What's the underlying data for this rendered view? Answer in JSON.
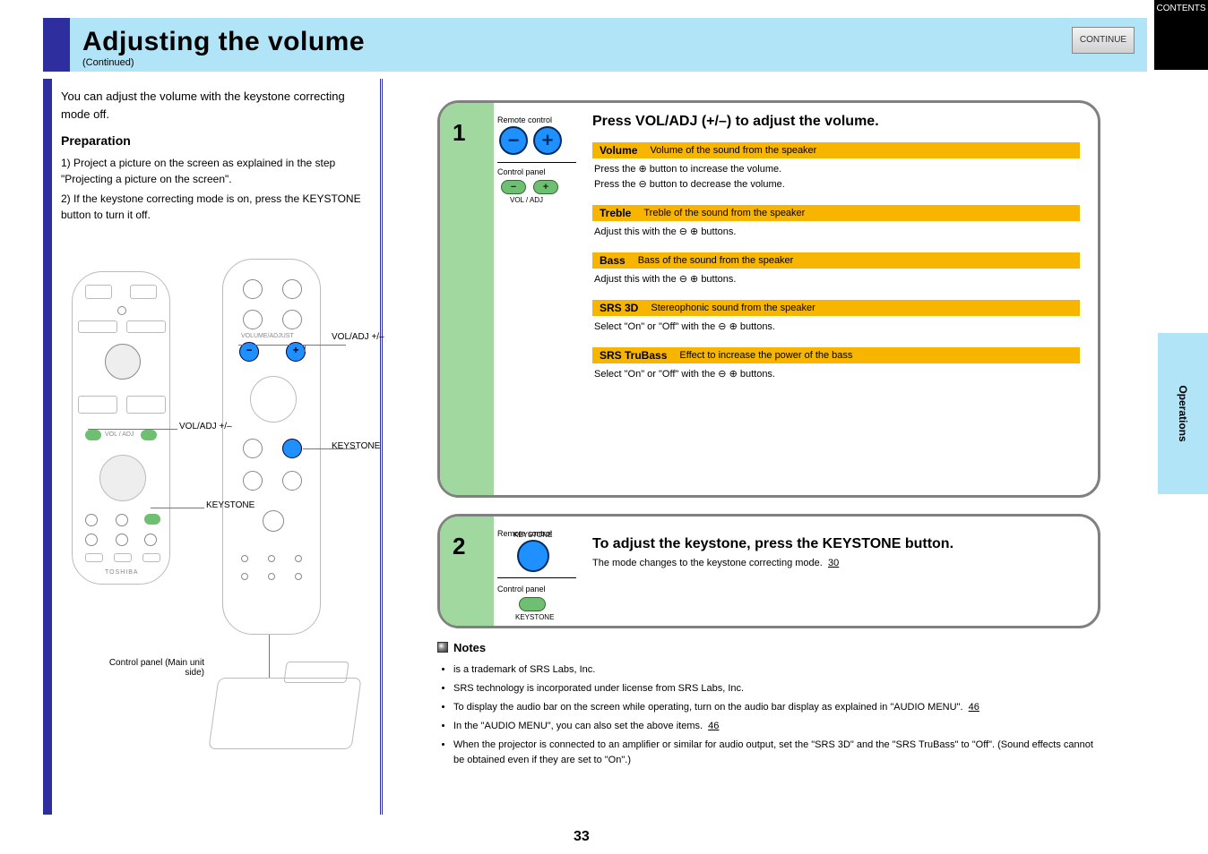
{
  "header": {
    "title": "Adjusting the volume",
    "subtitle": "(Continued)",
    "continue_btn": "CONTINUE",
    "contents_tab": "CONTENTS"
  },
  "side_tab": "Operations",
  "page_number": "33",
  "left": {
    "intro": "You can adjust the volume with the keystone correcting mode off.",
    "preparation_title": "Preparation",
    "preparation_items": [
      "1) Project a picture on the screen as explained in the step \"Projecting a picture on the screen\".",
      "2) If the keystone correcting mode is on, press the KEYSTONE button to turn it off."
    ],
    "callouts": {
      "vol_plus_minus_top": "VOL/ADJ +/–",
      "vol_plus_minus_left": "VOL/ADJ +/–",
      "keystone_right": "KEYSTONE",
      "keystone_left": "KEYSTONE",
      "control_panel": "Control panel (Main unit side)"
    },
    "remote_brand": "TOSHIBA",
    "volume_word_top": "VOLUME/ADJUST",
    "volume_word_bottom": "VOL / ADJ"
  },
  "right": {
    "step1": {
      "num": "1",
      "remote_label": "Remote control",
      "control_label": "Control panel",
      "title": "Press VOL/ADJ (+/–) to adjust the volume.",
      "bars": [
        {
          "name": "Volume",
          "desc": "Volume of the sound from the speaker",
          "lines": [
            "Press the ⊕ button to increase the volume.",
            "Press the ⊖ button to decrease the volume."
          ]
        },
        {
          "name": "Treble",
          "desc": "Treble of the sound from the speaker",
          "lines": [
            "Adjust this with the ⊖ ⊕ buttons."
          ]
        },
        {
          "name": "Bass",
          "desc": "Bass of the sound from the speaker",
          "lines": [
            "Adjust this with the ⊖ ⊕ buttons."
          ]
        },
        {
          "name": "SRS 3D",
          "desc": "Stereophonic sound from the speaker",
          "lines": [
            "Select \"On\" or \"Off\" with the ⊖ ⊕ buttons."
          ]
        },
        {
          "name": "SRS TruBass",
          "desc": "Effect to increase the power of the bass",
          "lines": [
            "Select \"On\" or \"Off\" with the ⊖ ⊕ buttons."
          ]
        }
      ]
    },
    "step2": {
      "num": "2",
      "remote_label": "Remote control",
      "control_label": "Control panel",
      "keystone_label": "KEYSTONE",
      "title": "To adjust the keystone, press the KEYSTONE button.",
      "sub": "The mode changes to the keystone correcting mode.",
      "ref": "30"
    }
  },
  "notes": {
    "heading": "Notes",
    "items": [
      "is a trademark of SRS Labs, Inc.",
      "SRS technology is incorporated under license from SRS Labs, Inc.",
      "To display the audio bar on the screen while operating, turn on the audio bar display as explained in \"AUDIO MENU\".",
      "In the \"AUDIO MENU\", you can also set the above items.",
      "When the projector is connected to an amplifier or similar for audio output, set the \"SRS 3D\" and the \"SRS TruBass\" to \"Off\". (Sound effects cannot be obtained even if they are set to \"On\".)"
    ],
    "ref": "46"
  }
}
